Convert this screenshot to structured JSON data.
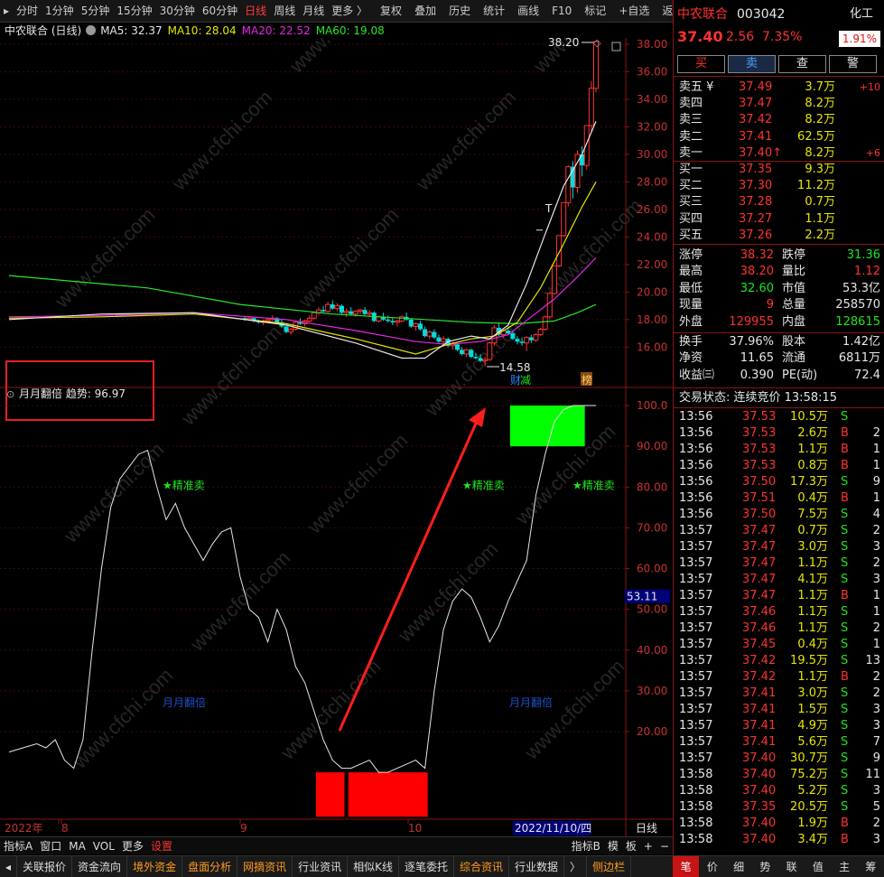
{
  "toolbar": {
    "periods": [
      "分时",
      "1分钟",
      "5分钟",
      "15分钟",
      "30分钟",
      "60分钟",
      "日线",
      "周线",
      "月线",
      "更多 〉"
    ],
    "active_period": "日线",
    "tools": [
      "复权",
      "叠加",
      "历史",
      "统计",
      "画线",
      "F10",
      "标记",
      "+自选",
      "返回"
    ]
  },
  "chart": {
    "stock_title": "中农联合 (日线)",
    "ma": [
      {
        "label": "MA5: 32.37",
        "color": "#e6e6e6"
      },
      {
        "label": "MA10: 28.04",
        "color": "#e6e600"
      },
      {
        "label": "MA20: 22.52",
        "color": "#e628e6"
      },
      {
        "label": "MA60: 19.08",
        "color": "#28e628"
      }
    ],
    "price_axis": [
      "38.00",
      "36.00",
      "34.00",
      "32.00",
      "30.00",
      "28.00",
      "26.00",
      "24.00",
      "22.00",
      "20.00",
      "18.00",
      "16.00"
    ],
    "high_label": "38.20",
    "low_label": "14.58",
    "markers": {
      "cai": "财",
      "jian": "减",
      "bang": "榜"
    },
    "candles": [
      [
        18.1,
        18.2,
        17.9,
        18.0
      ],
      [
        18.0,
        18.2,
        17.9,
        18.1
      ],
      [
        18.1,
        18.2,
        17.8,
        17.9
      ],
      [
        17.9,
        18.0,
        17.7,
        17.8
      ],
      [
        17.8,
        18.0,
        17.6,
        17.9
      ],
      [
        17.9,
        18.1,
        17.8,
        18.0
      ],
      [
        18.0,
        18.3,
        17.9,
        18.1
      ],
      [
        18.1,
        18.2,
        17.7,
        17.8
      ],
      [
        17.8,
        18.0,
        17.4,
        17.5
      ],
      [
        17.5,
        17.6,
        17.0,
        17.1
      ],
      [
        17.1,
        17.4,
        16.9,
        17.3
      ],
      [
        17.3,
        17.9,
        17.2,
        17.8
      ],
      [
        17.8,
        18.1,
        17.6,
        17.7
      ],
      [
        17.7,
        18.0,
        17.5,
        17.9
      ],
      [
        17.9,
        18.3,
        17.8,
        18.1
      ],
      [
        18.1,
        18.6,
        18.0,
        18.5
      ],
      [
        18.5,
        18.9,
        18.3,
        18.7
      ],
      [
        18.7,
        19.0,
        18.5,
        18.6
      ],
      [
        18.6,
        19.3,
        18.5,
        19.1
      ],
      [
        19.1,
        19.4,
        18.7,
        18.8
      ],
      [
        18.8,
        19.2,
        18.6,
        19.0
      ],
      [
        19.0,
        19.1,
        18.4,
        18.5
      ],
      [
        18.5,
        18.8,
        18.2,
        18.6
      ],
      [
        18.6,
        18.9,
        18.3,
        18.4
      ],
      [
        18.4,
        18.7,
        18.2,
        18.6
      ],
      [
        18.6,
        18.8,
        18.4,
        18.7
      ],
      [
        18.7,
        18.9,
        18.3,
        18.4
      ],
      [
        18.4,
        18.7,
        18.2,
        18.5
      ],
      [
        18.5,
        18.6,
        17.8,
        17.9
      ],
      [
        17.9,
        18.3,
        17.8,
        18.2
      ],
      [
        18.2,
        18.5,
        17.9,
        18.0
      ],
      [
        18.0,
        18.3,
        17.8,
        17.9
      ],
      [
        17.9,
        18.1,
        17.6,
        17.8
      ],
      [
        17.8,
        18.0,
        17.5,
        17.9
      ],
      [
        17.9,
        18.3,
        17.8,
        18.2
      ],
      [
        18.2,
        18.5,
        17.9,
        18.0
      ],
      [
        18.0,
        18.1,
        17.4,
        17.5
      ],
      [
        17.5,
        17.8,
        17.2,
        17.7
      ],
      [
        17.7,
        17.9,
        17.2,
        17.3
      ],
      [
        17.3,
        17.5,
        16.7,
        16.8
      ],
      [
        16.8,
        17.2,
        16.6,
        17.1
      ],
      [
        17.1,
        17.3,
        16.6,
        16.7
      ],
      [
        16.7,
        16.9,
        16.3,
        16.4
      ],
      [
        16.4,
        16.8,
        16.2,
        16.6
      ],
      [
        16.6,
        16.7,
        16.0,
        16.1
      ],
      [
        16.1,
        16.4,
        15.8,
        16.2
      ],
      [
        16.2,
        16.3,
        15.7,
        15.8
      ],
      [
        15.8,
        16.0,
        15.4,
        15.5
      ],
      [
        15.5,
        15.9,
        15.3,
        15.8
      ],
      [
        15.8,
        15.9,
        15.2,
        15.3
      ],
      [
        15.3,
        15.6,
        15.1,
        15.2
      ],
      [
        15.2,
        15.5,
        14.9,
        15.0
      ],
      [
        15.0,
        15.3,
        14.58,
        15.1
      ],
      [
        15.1,
        16.4,
        15.0,
        16.3
      ],
      [
        16.3,
        17.6,
        16.1,
        17.4
      ],
      [
        17.4,
        17.7,
        16.8,
        16.9
      ],
      [
        16.9,
        17.3,
        16.7,
        17.2
      ],
      [
        17.2,
        17.5,
        16.9,
        17.0
      ],
      [
        17.0,
        17.2,
        16.5,
        16.6
      ],
      [
        16.6,
        16.8,
        16.2,
        16.4
      ],
      [
        16.4,
        16.7,
        16.1,
        16.3
      ],
      [
        16.3,
        16.8,
        15.7,
        16.7
      ],
      [
        16.7,
        16.9,
        16.3,
        16.5
      ],
      [
        16.5,
        17.0,
        16.4,
        16.9
      ],
      [
        16.9,
        17.4,
        16.8,
        17.3
      ],
      [
        17.3,
        18.3,
        17.2,
        18.2
      ],
      [
        18.2,
        20.0,
        18.0,
        19.9
      ],
      [
        19.9,
        21.9,
        19.8,
        21.9
      ],
      [
        21.9,
        24.1,
        21.8,
        24.1
      ],
      [
        24.1,
        26.5,
        24.0,
        26.5
      ],
      [
        26.5,
        29.2,
        26.2,
        29.1
      ],
      [
        29.1,
        29.5,
        26.8,
        27.6
      ],
      [
        27.6,
        30.3,
        27.2,
        30.0
      ],
      [
        30.0,
        30.6,
        28.4,
        29.2
      ],
      [
        29.2,
        32.1,
        28.9,
        32.1
      ],
      [
        32.1,
        35.3,
        31.6,
        34.8
      ],
      [
        34.8,
        38.2,
        34.5,
        38.2
      ]
    ],
    "ma_lines": {
      "ma60": [
        [
          0,
          21.2
        ],
        [
          30,
          20.3
        ],
        [
          50,
          19.1
        ],
        [
          70,
          18.4
        ],
        [
          90,
          18.0
        ],
        [
          100,
          17.8
        ],
        [
          110,
          17.7
        ],
        [
          118,
          17.9
        ],
        [
          123,
          18.5
        ],
        [
          127,
          19.1
        ]
      ],
      "ma20": [
        [
          0,
          18.2
        ],
        [
          20,
          18.3
        ],
        [
          40,
          18.5
        ],
        [
          60,
          18.0
        ],
        [
          75,
          17.2
        ],
        [
          88,
          16.4
        ],
        [
          95,
          16.2
        ],
        [
          102,
          16.4
        ],
        [
          108,
          16.9
        ],
        [
          113,
          18.2
        ],
        [
          118,
          19.5
        ],
        [
          123,
          21.1
        ],
        [
          127,
          22.5
        ]
      ],
      "ma10": [
        [
          0,
          18.1
        ],
        [
          20,
          18.2
        ],
        [
          40,
          18.4
        ],
        [
          60,
          17.7
        ],
        [
          75,
          16.6
        ],
        [
          88,
          15.5
        ],
        [
          95,
          16.2
        ],
        [
          100,
          16.6
        ],
        [
          105,
          16.8
        ],
        [
          110,
          17.8
        ],
        [
          115,
          20.3
        ],
        [
          120,
          23.5
        ],
        [
          124,
          26.2
        ],
        [
          127,
          28.0
        ]
      ],
      "ma5": [
        [
          0,
          18.0
        ],
        [
          20,
          18.4
        ],
        [
          40,
          18.5
        ],
        [
          60,
          17.6
        ],
        [
          75,
          16.3
        ],
        [
          85,
          15.2
        ],
        [
          90,
          15.2
        ],
        [
          95,
          16.4
        ],
        [
          100,
          16.8
        ],
        [
          104,
          16.6
        ],
        [
          108,
          17.6
        ],
        [
          112,
          20.6
        ],
        [
          116,
          24.2
        ],
        [
          120,
          27.7
        ],
        [
          124,
          30.0
        ],
        [
          127,
          32.4
        ]
      ]
    },
    "time_axis": [
      "2022年",
      "8",
      "9",
      "10",
      "2022/11/10/四"
    ],
    "indicator": {
      "name": "月月翻倍",
      "trend_label": "月月翻倍  趋势: 96.97",
      "axis": [
        "100.0",
        "90.00",
        "80.00",
        "70.00",
        "60.00",
        "50.00",
        "40.00",
        "30.00",
        "20.00"
      ],
      "current_value": "53.11",
      "signal_label": "★精准卖",
      "watermark_label": "月月翻倍",
      "line": [
        [
          0,
          15
        ],
        [
          3,
          16
        ],
        [
          6,
          17
        ],
        [
          8,
          16
        ],
        [
          10,
          18
        ],
        [
          12,
          13
        ],
        [
          14,
          11
        ],
        [
          16,
          18
        ],
        [
          18,
          40
        ],
        [
          20,
          60
        ],
        [
          22,
          75
        ],
        [
          24,
          82
        ],
        [
          26,
          85
        ],
        [
          28,
          88
        ],
        [
          30,
          89
        ],
        [
          32,
          80
        ],
        [
          34,
          72
        ],
        [
          36,
          76
        ],
        [
          38,
          70
        ],
        [
          40,
          66
        ],
        [
          42,
          62
        ],
        [
          44,
          66
        ],
        [
          46,
          69
        ],
        [
          48,
          70
        ],
        [
          50,
          58
        ],
        [
          52,
          50
        ],
        [
          54,
          48
        ],
        [
          56,
          42
        ],
        [
          58,
          50
        ],
        [
          60,
          45
        ],
        [
          62,
          36
        ],
        [
          64,
          32
        ],
        [
          66,
          25
        ],
        [
          68,
          18
        ],
        [
          70,
          13
        ],
        [
          72,
          11
        ],
        [
          74,
          11
        ],
        [
          76,
          12
        ],
        [
          78,
          13
        ],
        [
          80,
          10
        ],
        [
          82,
          10
        ],
        [
          84,
          11
        ],
        [
          86,
          12
        ],
        [
          88,
          13
        ],
        [
          90,
          11
        ],
        [
          92,
          30
        ],
        [
          94,
          45
        ],
        [
          96,
          52
        ],
        [
          98,
          55
        ],
        [
          100,
          53
        ],
        [
          102,
          48
        ],
        [
          104,
          42
        ],
        [
          106,
          46
        ],
        [
          108,
          52
        ],
        [
          110,
          57
        ],
        [
          112,
          62
        ],
        [
          114,
          78
        ],
        [
          116,
          88
        ],
        [
          118,
          96
        ],
        [
          120,
          99
        ],
        [
          122,
          100
        ],
        [
          124,
          100
        ],
        [
          126,
          100
        ],
        [
          127,
          100
        ]
      ],
      "red_boxes": [
        [
          67,
          72
        ],
        [
          74,
          90
        ]
      ],
      "green_box": [
        109,
        124
      ]
    }
  },
  "quote": {
    "name": "中农联合",
    "code": "003042",
    "sector": "化工",
    "price": "37.40",
    "change": "2.56",
    "change_pct": "7.35%",
    "sector_pct": "1.91%",
    "buttons": [
      "买",
      "卖",
      "查",
      "警"
    ],
    "asks": [
      {
        "label": "卖五 ¥",
        "price": "37.49",
        "vol": "3.7万",
        "diff": "+10"
      },
      {
        "label": "卖四",
        "price": "37.47",
        "vol": "8.2万",
        "diff": ""
      },
      {
        "label": "卖三",
        "price": "37.42",
        "vol": "8.2万",
        "diff": ""
      },
      {
        "label": "卖二",
        "price": "37.41",
        "vol": "62.5万",
        "diff": ""
      },
      {
        "label": "卖一",
        "price": "37.40↑",
        "vol": "8.2万",
        "diff": "+6"
      }
    ],
    "bids": [
      {
        "label": "买一",
        "price": "37.35",
        "vol": "9.3万"
      },
      {
        "label": "买二",
        "price": "37.30",
        "vol": "11.2万"
      },
      {
        "label": "买三",
        "price": "37.28",
        "vol": "0.7万"
      },
      {
        "label": "买四",
        "price": "37.27",
        "vol": "1.1万"
      },
      {
        "label": "买五",
        "price": "37.26",
        "vol": "2.2万"
      }
    ],
    "stats1": [
      {
        "l1": "涨停",
        "v1": "38.32",
        "c1": "red",
        "l2": "跌停",
        "v2": "31.36",
        "c2": "green"
      },
      {
        "l1": "最高",
        "v1": "38.20",
        "c1": "red",
        "l2": "量比",
        "v2": "1.12",
        "c2": "red"
      },
      {
        "l1": "最低",
        "v1": "32.60",
        "c1": "green",
        "l2": "市值",
        "v2": "53.3亿",
        "c2": "white"
      },
      {
        "l1": "现量",
        "v1": "9",
        "c1": "red",
        "l2": "总量",
        "v2": "258570",
        "c2": "white"
      },
      {
        "l1": "外盘",
        "v1": "129955",
        "c1": "red",
        "l2": "内盘",
        "v2": "128615",
        "c2": "green"
      }
    ],
    "stats2": [
      {
        "l1": "换手",
        "v1": "37.96%",
        "l2": "股本",
        "v2": "1.42亿"
      },
      {
        "l1": "净资",
        "v1": "11.65",
        "l2": "流通",
        "v2": "6811万"
      },
      {
        "l1": "收益㈢",
        "v1": "0.390",
        "l2": "PE(动)",
        "v2": "72.4"
      }
    ],
    "trade_status": "交易状态: 连续竞价 13:58:15",
    "ticks": [
      [
        "13:56",
        "37.53",
        "10.5万",
        "S",
        ""
      ],
      [
        "13:56",
        "37.53",
        "2.6万",
        "B",
        "2"
      ],
      [
        "13:56",
        "37.53",
        "1.1万",
        "B",
        "1"
      ],
      [
        "13:56",
        "37.53",
        "0.8万",
        "B",
        "1"
      ],
      [
        "13:56",
        "37.50",
        "17.3万",
        "S",
        "9"
      ],
      [
        "13:56",
        "37.51",
        "0.4万",
        "B",
        "1"
      ],
      [
        "13:56",
        "37.50",
        "7.5万",
        "S",
        "4"
      ],
      [
        "13:57",
        "37.47",
        "0.7万",
        "S",
        "2"
      ],
      [
        "13:57",
        "37.47",
        "3.0万",
        "S",
        "3"
      ],
      [
        "13:57",
        "37.47",
        "1.1万",
        "S",
        "2"
      ],
      [
        "13:57",
        "37.47",
        "4.1万",
        "S",
        "3"
      ],
      [
        "13:57",
        "37.47",
        "1.1万",
        "B",
        "1"
      ],
      [
        "13:57",
        "37.46",
        "1.1万",
        "S",
        "1"
      ],
      [
        "13:57",
        "37.46",
        "1.1万",
        "S",
        "2"
      ],
      [
        "13:57",
        "37.45",
        "0.4万",
        "S",
        "1"
      ],
      [
        "13:57",
        "37.42",
        "19.5万",
        "S",
        "13"
      ],
      [
        "13:57",
        "37.42",
        "1.1万",
        "B",
        "2"
      ],
      [
        "13:57",
        "37.41",
        "3.0万",
        "S",
        "2"
      ],
      [
        "13:57",
        "37.41",
        "1.5万",
        "S",
        "3"
      ],
      [
        "13:57",
        "37.41",
        "4.9万",
        "S",
        "3"
      ],
      [
        "13:57",
        "37.41",
        "5.6万",
        "S",
        "7"
      ],
      [
        "13:57",
        "37.40",
        "30.7万",
        "S",
        "9"
      ],
      [
        "13:58",
        "37.40",
        "75.2万",
        "S",
        "11"
      ],
      [
        "13:58",
        "37.40",
        "5.2万",
        "S",
        "3"
      ],
      [
        "13:58",
        "37.35",
        "20.5万",
        "S",
        "5"
      ],
      [
        "13:58",
        "37.40",
        "1.9万",
        "B",
        "2"
      ],
      [
        "13:58",
        "37.40",
        "3.4万",
        "B",
        "3"
      ]
    ],
    "tabs": [
      "笔",
      "价",
      "细",
      "势",
      "联",
      "值",
      "主",
      "筹"
    ]
  },
  "indicator_bar": {
    "left": [
      "指标A",
      "窗口",
      "MA",
      "VOL",
      "更多",
      "设置"
    ],
    "right": [
      "指标B",
      "模",
      "板",
      "+",
      "−"
    ],
    "period_label": "日线"
  },
  "function_bar": [
    "关联报价",
    "资金流向",
    "境外资金",
    "盘面分析",
    "网摘资讯",
    "行业资讯",
    "相似K线",
    "逐笔委托",
    "综合资讯",
    "行业数据",
    "〉",
    "侧边栏"
  ],
  "function_bar_orange": [
    "境外资金",
    "盘面分析",
    "网摘资讯",
    "综合资讯",
    "侧边栏"
  ],
  "watermark": "www.cfchi.com"
}
